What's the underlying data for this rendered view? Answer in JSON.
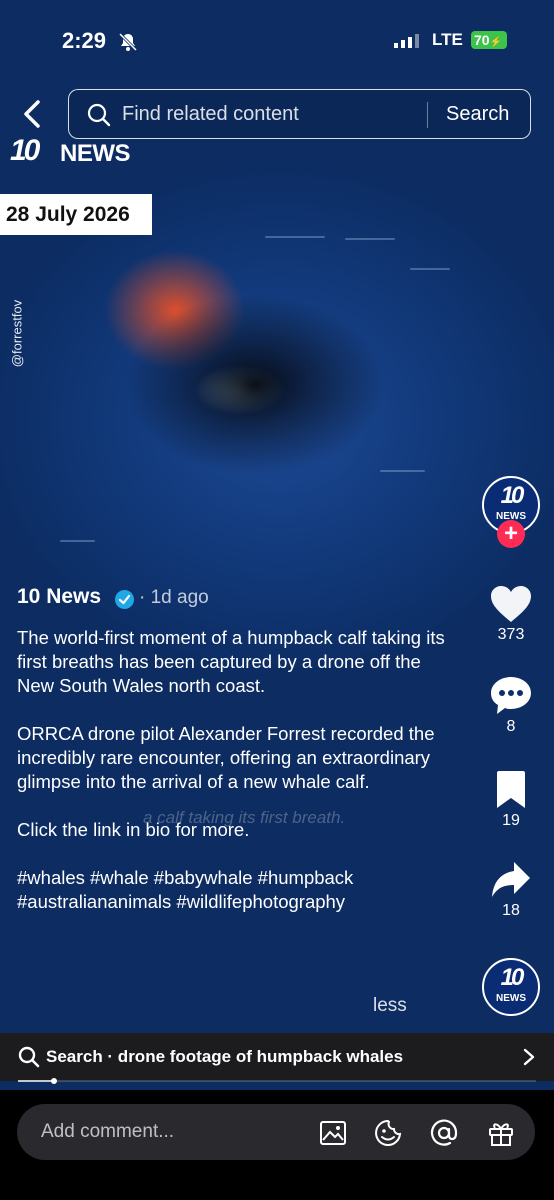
{
  "status_bar": {
    "time": "2:29",
    "network": "LTE",
    "battery": "70"
  },
  "search": {
    "placeholder": "Find related content",
    "button_label": "Search"
  },
  "video": {
    "brand_number": "10",
    "brand_name": "NEWS",
    "date": "28 July 2026",
    "credit": "@forrestfov",
    "subtitle": "a calf taking its first breath."
  },
  "rail": {
    "avatar_number": "10",
    "avatar_name": "NEWS",
    "follow_symbol": "+",
    "likes": "373",
    "comments": "8",
    "saves": "19",
    "shares": "18"
  },
  "post": {
    "author": "10 News",
    "meta": "· 1d ago",
    "caption": "The world-first moment of a humpback calf taking its first breaths has been captured by a drone off the New South Wales north coast.\n\nORRCA drone pilot Alexander Forrest recorded the incredibly rare encounter, offering an extraordinary glimpse into the arrival of a new whale calf.\n\nClick the link in bio for more.\n\n#whales #whale #babywhale #humpback #australiananimals #wildlifephotography",
    "less_label": "less"
  },
  "related_search": {
    "label": "Search · drone footage of humpback whales"
  },
  "playback": {
    "progress_fraction": 0.07
  },
  "comment": {
    "placeholder": "Add comment..."
  },
  "colors": {
    "accent_follow": "#fe2c55",
    "verified": "#20a7e8",
    "battery": "#3ec34a"
  }
}
